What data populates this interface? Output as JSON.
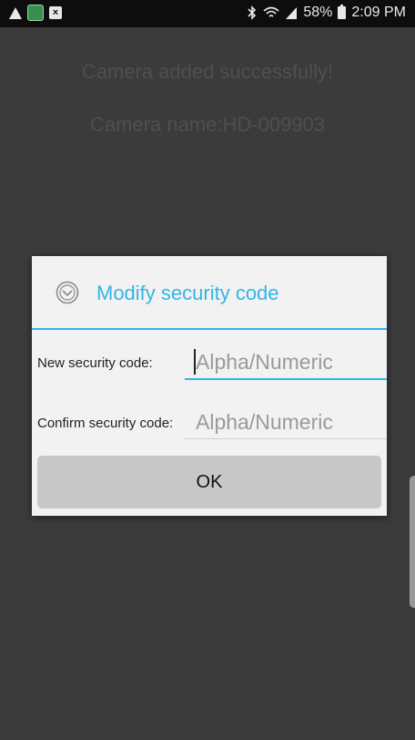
{
  "status_bar": {
    "battery": "58%",
    "time": "2:09 PM"
  },
  "background": {
    "line1": "Camera added successfully!",
    "line2": "Camera name:HD-009903"
  },
  "dialog": {
    "title": "Modify security code",
    "new_code_label": "New security code:",
    "new_code_placeholder": "Alpha/Numeric",
    "confirm_label": "Confirm security code:",
    "confirm_placeholder": "Alpha/Numeric",
    "ok_label": "OK"
  },
  "colors": {
    "accent": "#33b5e5"
  }
}
